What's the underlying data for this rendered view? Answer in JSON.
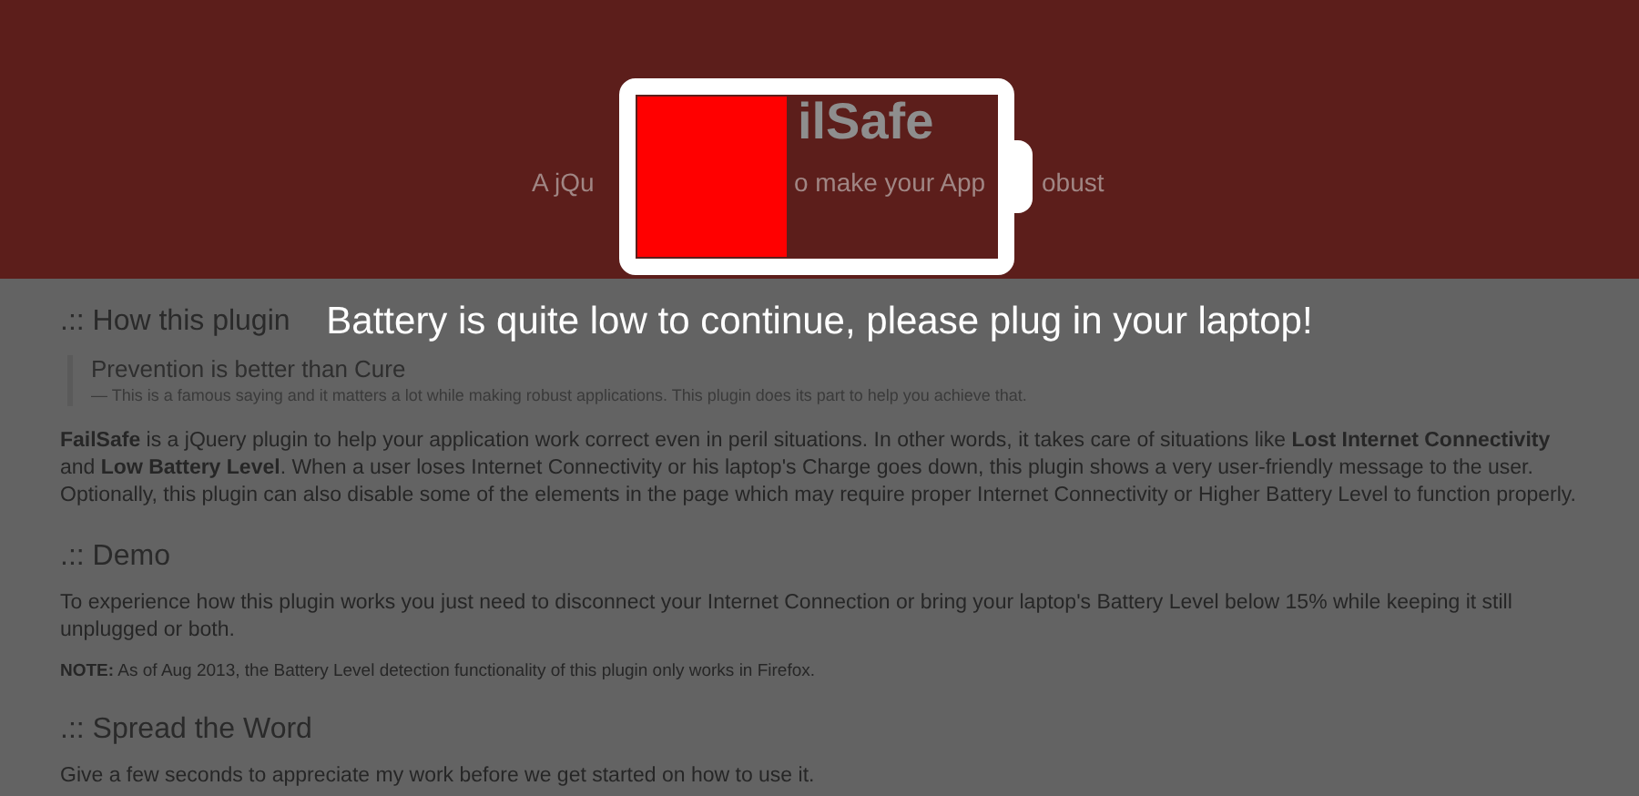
{
  "header": {
    "title": "ilSafe",
    "subtitle_parts": [
      "A jQu",
      "o make your App",
      "obust"
    ]
  },
  "sections": [
    {
      "heading": ".:: How this plugin",
      "quote": {
        "text": "Prevention is better than Cure",
        "footer": "— This is a famous saying and it matters a lot while making robust applications. This plugin does its part to help you achieve that."
      },
      "paragraphs": [
        {
          "kind": "body",
          "text": "**FailSafe** is a jQuery plugin to help your application work correct even in peril situations. In other words, it takes care of situations like **Lost Internet Connectivity** and **Low Battery Level**. When a user loses Internet Connectivity or his laptop's Charge goes down, this plugin shows a very user-friendly message to the user. Optionally, this plugin can also disable some of the elements in the page which may require proper Internet Connectivity or Higher Battery Level to function properly."
        }
      ]
    },
    {
      "heading": ".:: Demo",
      "paragraphs": [
        {
          "kind": "body",
          "text": "To experience how this plugin works you just need to disconnect your Internet Connection or bring your laptop's Battery Level below 15% while keeping it still unplugged or both."
        },
        {
          "kind": "note",
          "text": "**NOTE:** As of Aug 2013, the Battery Level detection functionality of this plugin only works in Firefox."
        }
      ]
    },
    {
      "heading": ".:: Spread the Word",
      "paragraphs": [
        {
          "kind": "body",
          "text": "Give a few seconds to appreciate my work before we get started on how to use it."
        }
      ]
    }
  ],
  "overlay": {
    "message": "Battery is quite low to continue, please plug in your laptop!"
  }
}
